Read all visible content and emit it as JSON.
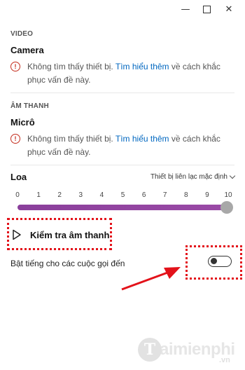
{
  "window": {
    "minimize_glyph": "—",
    "maximize_glyph": "",
    "close_glyph": "✕"
  },
  "video": {
    "section_label": "VIDEO",
    "device_title": "Camera",
    "warning_text": "Không tìm thấy thiết bị. ",
    "warning_link": "Tìm hiểu thêm",
    "warning_suffix": " về cách khắc phục vấn đề này."
  },
  "audio": {
    "section_label": "ÂM THANH",
    "mic_title": "Micrô",
    "warning_text": "Không tìm thấy thiết bị. ",
    "warning_link": "Tìm hiểu thêm",
    "warning_suffix": " về cách khắc phục vấn đề này."
  },
  "speaker": {
    "label": "Loa",
    "selected_device": "Thiết bị liên lạc mặc định",
    "volume_ticks": [
      "0",
      "1",
      "2",
      "3",
      "4",
      "5",
      "6",
      "7",
      "8",
      "9",
      "10"
    ],
    "volume_value": 10,
    "volume_max": 10
  },
  "test_button": {
    "label": "Kiểm tra âm thanh"
  },
  "incoming_ring": {
    "label": "Bật tiếng cho các cuộc gọi đến",
    "enabled": false
  },
  "watermark": {
    "logo_letter": "T",
    "brand": "aimienphi",
    "tld": ".vn"
  },
  "colors": {
    "accent_link": "#0067c0",
    "warning": "#c42b1c",
    "slider_fill": "#8a3f9b",
    "annotation_red": "#e3121a"
  },
  "icons": {
    "warning": "warning-circle-icon",
    "play": "play-icon",
    "chevron": "chevron-down-icon"
  }
}
